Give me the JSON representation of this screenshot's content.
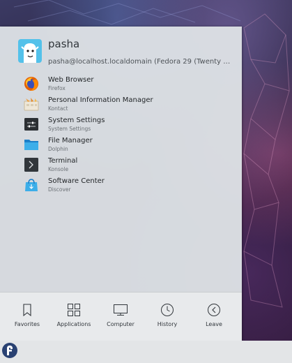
{
  "user": {
    "name": "pasha",
    "host": "pasha@localhost.localdomain (Fedora 29 (Twenty Ni..."
  },
  "apps": [
    {
      "name": "Web Browser",
      "sub": "Firefox",
      "icon": "firefox-icon"
    },
    {
      "name": "Personal Information Manager",
      "sub": "Kontact",
      "icon": "kontact-icon"
    },
    {
      "name": "System Settings",
      "sub": "System Settings",
      "icon": "settings-icon"
    },
    {
      "name": "File Manager",
      "sub": "Dolphin",
      "icon": "folder-icon"
    },
    {
      "name": "Terminal",
      "sub": "Konsole",
      "icon": "terminal-icon"
    },
    {
      "name": "Software Center",
      "sub": "Discover",
      "icon": "discover-icon"
    }
  ],
  "tabs": [
    {
      "label": "Favorites",
      "icon": "bookmark-icon",
      "active": true
    },
    {
      "label": "Applications",
      "icon": "grid-icon",
      "active": false
    },
    {
      "label": "Computer",
      "icon": "monitor-icon",
      "active": false
    },
    {
      "label": "History",
      "icon": "clock-icon",
      "active": false
    },
    {
      "label": "Leave",
      "icon": "leave-icon",
      "active": false
    }
  ],
  "colors": {
    "accent": "#3daee9",
    "menu_bg": "#dcdfe3",
    "avatar_bg": "#53c1ea",
    "fedora_blue": "#294172"
  }
}
